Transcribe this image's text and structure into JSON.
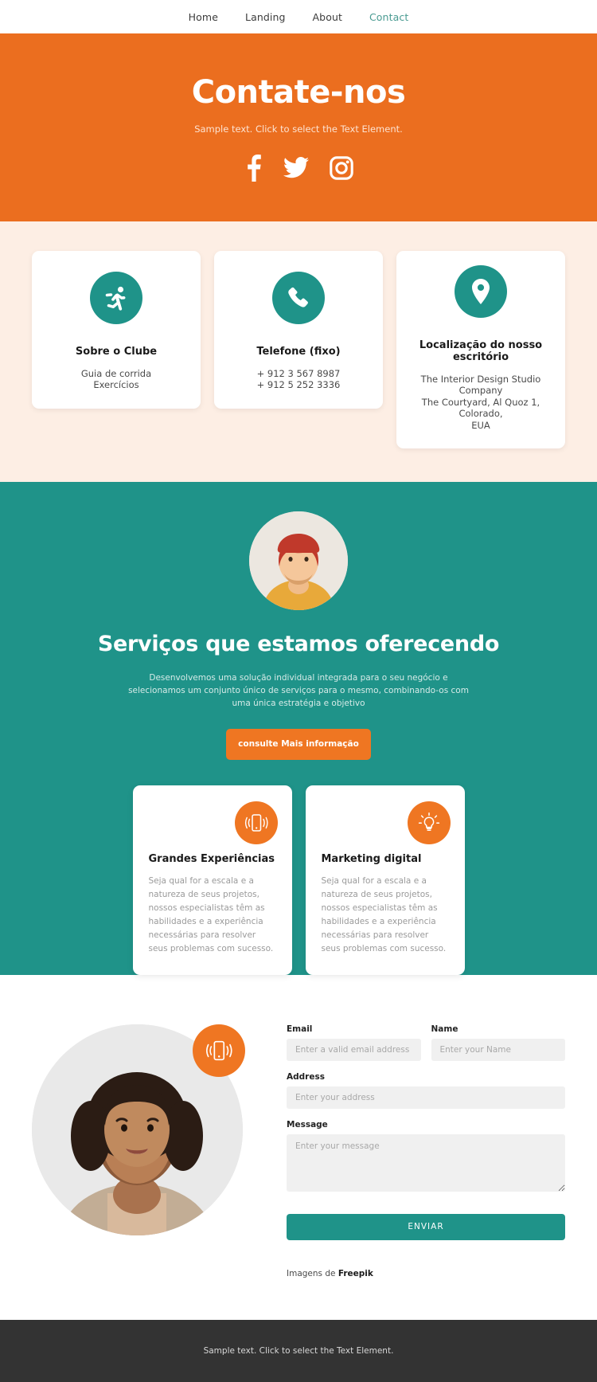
{
  "nav": {
    "items": [
      {
        "label": "Home",
        "active": false
      },
      {
        "label": "Landing",
        "active": false
      },
      {
        "label": "About",
        "active": false
      },
      {
        "label": "Contact",
        "active": true
      }
    ]
  },
  "hero": {
    "title": "Contate-nos",
    "subtitle": "Sample text. Click to select the Text Element.",
    "background": "#eb6e1f",
    "social": [
      {
        "name": "facebook-icon"
      },
      {
        "name": "twitter-icon"
      },
      {
        "name": "instagram-icon"
      }
    ]
  },
  "info_cards": {
    "background": "#fdeee4",
    "icon_color": "#1f9389",
    "items": [
      {
        "icon": "running-icon",
        "title": "Sobre o Clube",
        "lines": [
          "Guia de corrida",
          "Exercícios"
        ]
      },
      {
        "icon": "phone-icon",
        "title": "Telefone (fixo)",
        "lines": [
          "+ 912 3 567 8987",
          "+ 912 5 252 3336"
        ]
      },
      {
        "icon": "location-pin-icon",
        "title": "Localização do nosso escritório",
        "lines": [
          "The Interior Design Studio Company",
          "The Courtyard, Al Quoz 1, Colorado,",
          "EUA"
        ]
      }
    ]
  },
  "services": {
    "background": "#1f9389",
    "title": "Serviços que estamos oferecendo",
    "subtitle": "Desenvolvemos uma solução individual integrada para o seu negócio e selecionamos um conjunto único de serviços para o mesmo, combinando-os com uma única estratégia e objetivo",
    "cta_label": "consulte Mais informação",
    "cta_color": "#ef7622",
    "features": [
      {
        "icon": "mobile-vibrate-icon",
        "title": "Grandes Experiências",
        "body": "Seja qual for a escala e a natureza de seus projetos, nossos especialistas têm as habilidades e a experiência necessárias para resolver seus problemas com sucesso."
      },
      {
        "icon": "lightbulb-icon",
        "title": "Marketing digital",
        "body": "Seja qual for a escala e a natureza de seus projetos, nossos especialistas têm as habilidades e a experiência necessárias para resolver seus problemas com sucesso."
      }
    ]
  },
  "contact": {
    "badge_icon": "mobile-vibrate-icon",
    "fields": {
      "email": {
        "label": "Email",
        "placeholder": "Enter a valid email address",
        "value": ""
      },
      "name": {
        "label": "Name",
        "placeholder": "Enter your Name",
        "value": ""
      },
      "address": {
        "label": "Address",
        "placeholder": "Enter your address",
        "value": ""
      },
      "message": {
        "label": "Message",
        "placeholder": "Enter your message",
        "value": ""
      }
    },
    "submit_label": "ENVIAR",
    "submit_color": "#1f9389",
    "credit_prefix": "Imagens de ",
    "credit_source": "Freepik"
  },
  "footer": {
    "text": "Sample text. Click to select the Text Element.",
    "background": "#333333"
  }
}
